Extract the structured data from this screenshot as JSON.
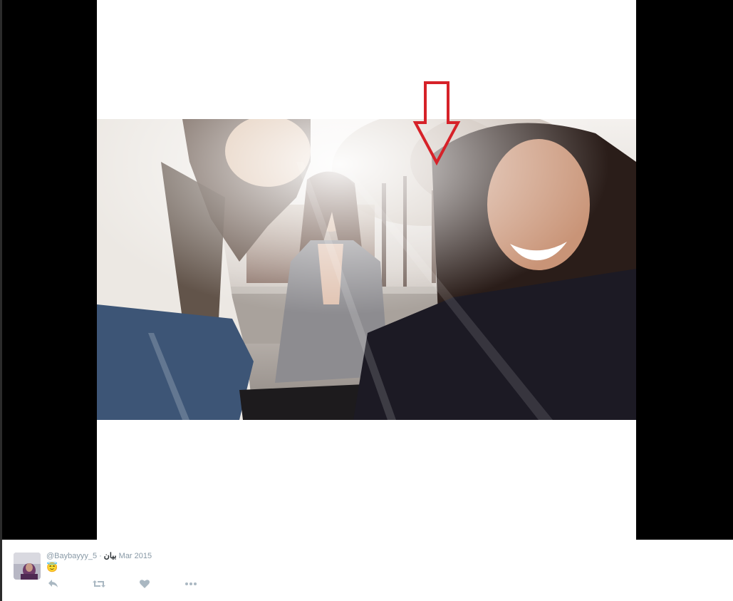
{
  "media": {
    "alt": "Photo"
  },
  "tweet": {
    "display_name": "بيان",
    "username": "@Baybayyy_",
    "separator": "·",
    "timestamp": "5 Mar 2015",
    "text": "😇"
  },
  "actions": [
    {
      "name": "reply-icon"
    },
    {
      "name": "retweet-icon"
    },
    {
      "name": "favorite-icon"
    },
    {
      "name": "more-icon"
    }
  ],
  "colors": {
    "background": "#000000",
    "meta_text": "#8899a6",
    "body_text": "#292f33",
    "annotation_arrow": "#d62229",
    "action_icon": "#aab8c2"
  }
}
